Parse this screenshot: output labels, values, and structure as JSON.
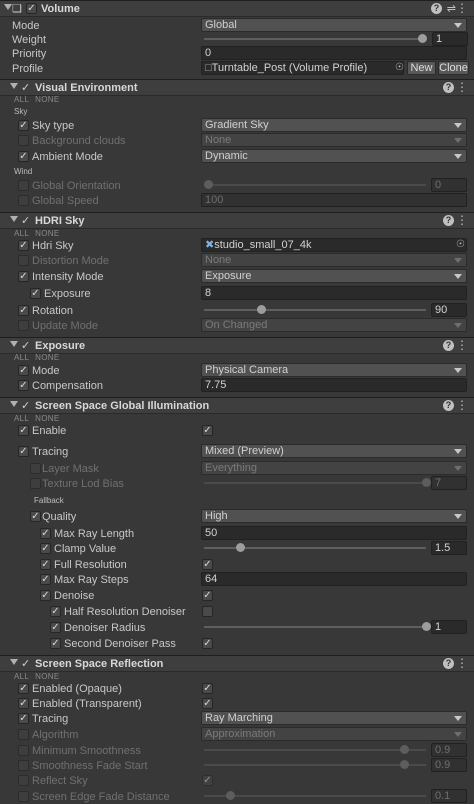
{
  "volume": {
    "title": "Volume",
    "mode_label": "Mode",
    "mode_value": "Global",
    "weight_label": "Weight",
    "weight_value": "1",
    "weight": 1,
    "priority_label": "Priority",
    "priority_value": "0",
    "profile_label": "Profile",
    "profile_value": "Turntable_Post (Volume Profile)",
    "new_label": "New",
    "clone_label": "Clone"
  },
  "all_label": "ALL",
  "none_label": "NONE",
  "visual_env": {
    "title": "Visual Environment",
    "sky_sub": "Sky",
    "sky_type_label": "Sky type",
    "sky_type_value": "Gradient Sky",
    "bg_clouds_label": "Background clouds",
    "bg_clouds_value": "None",
    "ambient_label": "Ambient Mode",
    "ambient_value": "Dynamic",
    "wind_sub": "Wind",
    "global_orient_label": "Global Orientation",
    "global_orient_value": "0",
    "global_orient": 0,
    "global_speed_label": "Global Speed",
    "global_speed_value": "100"
  },
  "hdri": {
    "title": "HDRI Sky",
    "hdri_label": "Hdri Sky",
    "hdri_value": "studio_small_07_4k",
    "distortion_label": "Distortion Mode",
    "distortion_value": "None",
    "intensity_label": "Intensity Mode",
    "intensity_value": "Exposure",
    "exposure_label": "Exposure",
    "exposure_value": "8",
    "rotation_label": "Rotation",
    "rotation_value": "90",
    "rotation": 0.25,
    "update_label": "Update Mode",
    "update_value": "On Changed"
  },
  "exposure": {
    "title": "Exposure",
    "mode_label": "Mode",
    "mode_value": "Physical Camera",
    "comp_label": "Compensation",
    "comp_value": "7.75"
  },
  "ssgi": {
    "title": "Screen Space Global Illumination",
    "enable_label": "Enable",
    "tracing_label": "Tracing",
    "tracing_value": "Mixed (Preview)",
    "layer_mask_label": "Layer Mask",
    "layer_mask_value": "Everything",
    "tex_lod_label": "Texture Lod Bias",
    "tex_lod_value": "7",
    "tex_lod": 1,
    "fallback_sub": "Fallback",
    "quality_label": "Quality",
    "quality_value": "High",
    "max_ray_len_label": "Max Ray Length",
    "max_ray_len_value": "50",
    "clamp_label": "Clamp Value",
    "clamp_value": "1.5",
    "clamp": 0.15,
    "full_res_label": "Full Resolution",
    "max_steps_label": "Max Ray Steps",
    "max_steps_value": "64",
    "denoise_label": "Denoise",
    "half_res_label": "Half Resolution Denoiser",
    "radius_label": "Denoiser Radius",
    "radius_value": "1",
    "radius": 1,
    "second_pass_label": "Second Denoiser Pass"
  },
  "ssr": {
    "title": "Screen Space Reflection",
    "enabled_opaque_label": "Enabled (Opaque)",
    "enabled_trans_label": "Enabled (Transparent)",
    "tracing_label": "Tracing",
    "tracing_value": "Ray Marching",
    "algorithm_label": "Algorithm",
    "algorithm_value": "Approximation",
    "min_smooth_label": "Minimum Smoothness",
    "min_smooth_value": "0.9",
    "min_smooth": 0.9,
    "smooth_fade_label": "Smoothness Fade Start",
    "smooth_fade_value": "0.9",
    "smooth_fade": 0.9,
    "reflect_sky_label": "Reflect Sky",
    "edge_fade_label": "Screen Edge Fade Distance",
    "edge_fade_value": "0.1",
    "edge_fade": 0.1
  },
  "colors": {
    "background": "#383838",
    "header": "#3e3e3e",
    "field": "#2a2a2a",
    "dropdown": "#515151"
  }
}
